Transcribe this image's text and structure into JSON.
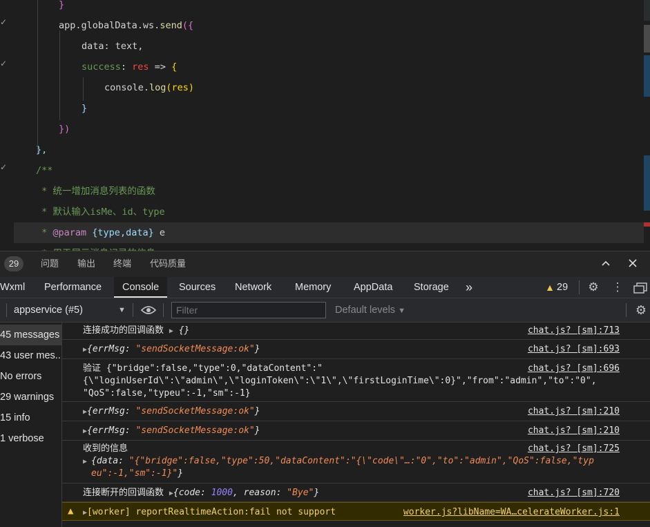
{
  "editor": {
    "lines": [
      {
        "indent": 2,
        "parts": [
          {
            "t": "}",
            "c": "t-brace2"
          }
        ]
      },
      {
        "indent": 2,
        "parts": [
          {
            "t": "app.globalData.ws.",
            "c": "t-punc"
          },
          {
            "t": "send",
            "c": "t-fn"
          },
          {
            "t": "({",
            "c": "t-brace2"
          }
        ]
      },
      {
        "indent": 3,
        "parts": [
          {
            "t": "data: text,",
            "c": "t-punc"
          }
        ]
      },
      {
        "indent": 3,
        "parts": [
          {
            "t": "success",
            "c": "t-green"
          },
          {
            "t": ": ",
            "c": "t-punc"
          },
          {
            "t": "res",
            "c": "t-red"
          },
          {
            "t": " => ",
            "c": "t-punc"
          },
          {
            "t": "{",
            "c": "t-brace"
          }
        ]
      },
      {
        "indent": 4,
        "parts": [
          {
            "t": "console.",
            "c": "t-punc"
          },
          {
            "t": "log",
            "c": "t-fn"
          },
          {
            "t": "(res)",
            "c": "t-brace"
          }
        ]
      },
      {
        "indent": 3,
        "parts": [
          {
            "t": "}",
            "c": "t-prop"
          }
        ]
      },
      {
        "indent": 2,
        "parts": [
          {
            "t": "})",
            "c": "t-brace2"
          }
        ]
      },
      {
        "indent": 1,
        "parts": [
          {
            "t": "},",
            "c": "t-prop"
          }
        ]
      },
      {
        "indent": 1,
        "parts": [
          {
            "t": "/**",
            "c": "t-com"
          }
        ]
      },
      {
        "indent": 1,
        "parts": [
          {
            "t": " * 统一增加消息列表的函数",
            "c": "t-com"
          }
        ]
      },
      {
        "indent": 1,
        "parts": [
          {
            "t": " * 默认输入isMe、id、type",
            "c": "t-com"
          }
        ]
      },
      {
        "indent": 1,
        "parts": [
          {
            "t": " * ",
            "c": "t-com"
          },
          {
            "t": "@param",
            "c": "t-key"
          },
          {
            "t": " {type,data}",
            "c": "t-prop"
          },
          {
            "t": " e",
            "c": "t-punc"
          }
        ]
      },
      {
        "indent": 1,
        "parts": [
          {
            "t": " * 用于展示消息记录的信息",
            "c": "t-com"
          }
        ]
      }
    ]
  },
  "panel_bar": {
    "count": "29",
    "tabs": [
      "问题",
      "输出",
      "终端",
      "代码质量"
    ],
    "collapse_icon": "chevron-up-icon",
    "close_icon": "close-icon"
  },
  "devtools": {
    "tabs": [
      "Wxml",
      "Performance",
      "Console",
      "Sources",
      "Network",
      "Memory",
      "AppData",
      "Storage"
    ],
    "active_tab": "Console",
    "more": "»",
    "warning_count": "29"
  },
  "toolbar": {
    "context": "appservice (#5)",
    "filter_placeholder": "Filter",
    "levels": "Default levels"
  },
  "sidebar": {
    "items": [
      "45 messages",
      "43 user mes...",
      "No errors",
      "29 warnings",
      "15 info",
      "1 verbose"
    ]
  },
  "messages": [
    {
      "text_pre": "连接成功的回调函数 ",
      "obj": "{}",
      "source": "chat.js? [sm]:713"
    },
    {
      "obj_key": "errMsg",
      "obj_val": "\"sendSocketMessage:ok\"",
      "source": "chat.js? [sm]:693"
    },
    {
      "text": "验证 {\"bridge\":false,\"type\":0,\"dataContent\":\"\n{\\\"loginUserId\\\":\\\"admin\\\",\\\"loginToken\\\":\\\"1\\\",\\\"firstLoginTime\\\":0}\",\"from\":\"admin\",\"to\":\"0\",\n\"QoS\":false,\"typeu\":-1,\"sm\":-1}",
      "source": "chat.js? [sm]:696"
    },
    {
      "obj_key": "errMsg",
      "obj_val": "\"sendSocketMessage:ok\"",
      "source": "chat.js? [sm]:210"
    },
    {
      "obj_key": "errMsg",
      "obj_val": "\"sendSocketMessage:ok\"",
      "source": "chat.js? [sm]:210"
    },
    {
      "text": "收到的信息",
      "data_key": "data",
      "data_val": "\"{\"bridge\":false,\"type\":50,\"dataContent\":\"{\\\"code\\\"…:\"0\",\"to\":\"admin\",\"QoS\":false,\"typ\neu\":-1,\"sm\":-1}\"",
      "source": "chat.js? [sm]:725"
    },
    {
      "text_pre": "连接断开的回调函数 ",
      "code_key": "code",
      "code_val": "1000",
      "reason_key": "reason",
      "reason_val": "\"Bye\"",
      "source": "chat.js? [sm]:720"
    },
    {
      "warn": "[worker] reportRealtimeAction:fail not support",
      "source": "worker.js?libName=WA…celerateWorker.js:1"
    }
  ]
}
